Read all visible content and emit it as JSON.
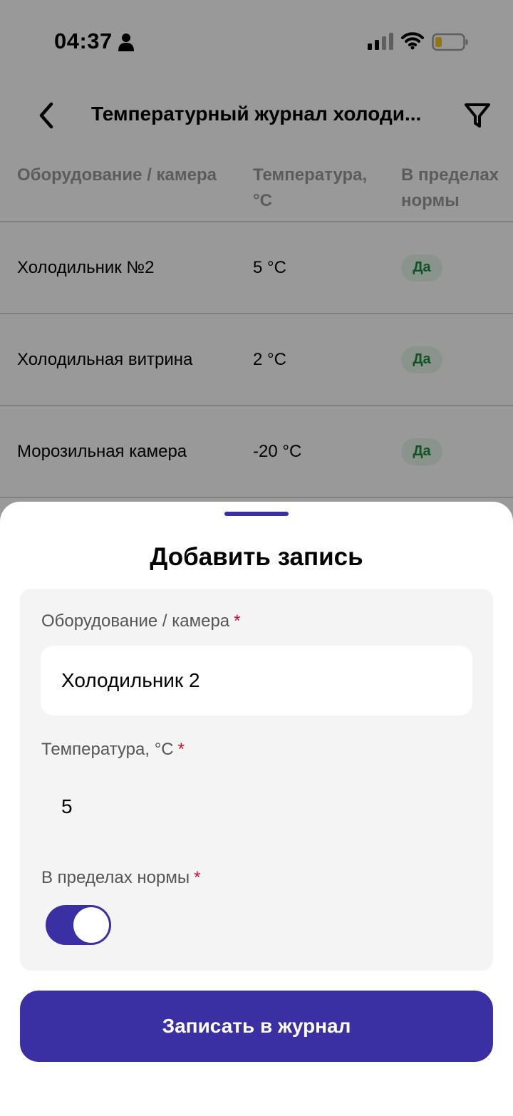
{
  "status_bar": {
    "time": "04:37"
  },
  "header": {
    "title": "Температурный журнал холоди..."
  },
  "table": {
    "columns": [
      "Оборудование / камера",
      "Температура, °C",
      "В пределах нормы"
    ],
    "rows": [
      {
        "equipment": "Холодильник №2",
        "temperature": "5 °C",
        "in_norm": "Да"
      },
      {
        "equipment": "Холодильная витрина",
        "temperature": "2 °C",
        "in_norm": "Да"
      },
      {
        "equipment": "Морозильная камера",
        "temperature": "-20 °C",
        "in_norm": "Да"
      }
    ]
  },
  "sheet": {
    "title": "Добавить запись",
    "required_mark": "*",
    "equipment_label": "Оборудование / камера",
    "equipment_value": "Холодильник 2",
    "temperature_label": "Температура, °C",
    "temperature_value": "5",
    "in_norm_label": "В пределах нормы",
    "in_norm_value": true,
    "submit_label": "Записать в журнал"
  },
  "colors": {
    "accent": "#3a2fa3",
    "badge_bg": "#e6f5ea",
    "badge_text": "#1c8a3e",
    "required": "#c8102e"
  },
  "icons": [
    "person-icon",
    "signal-icon",
    "wifi-icon",
    "battery-icon",
    "back-icon",
    "filter-icon"
  ]
}
